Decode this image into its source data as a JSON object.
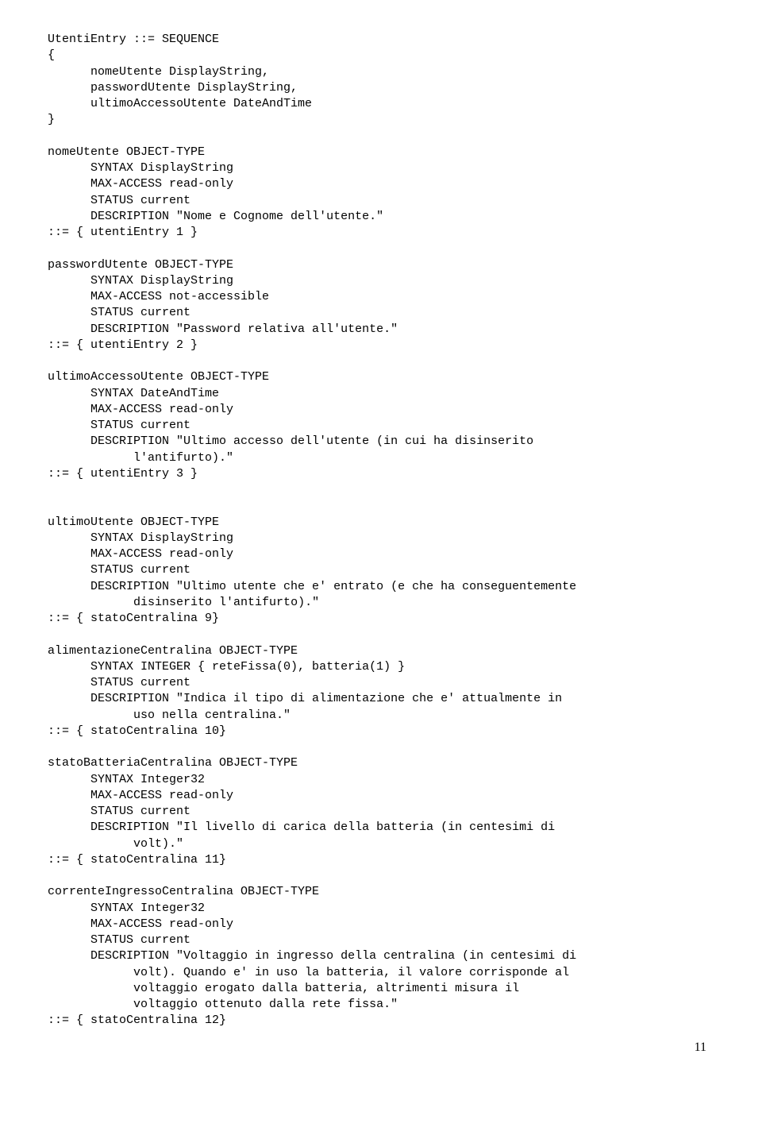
{
  "code": "UtentiEntry ::= SEQUENCE\n{\n      nomeUtente DisplayString,\n      passwordUtente DisplayString,\n      ultimoAccessoUtente DateAndTime\n}\n\nnomeUtente OBJECT-TYPE\n      SYNTAX DisplayString\n      MAX-ACCESS read-only\n      STATUS current\n      DESCRIPTION \"Nome e Cognome dell'utente.\"\n::= { utentiEntry 1 }\n\npasswordUtente OBJECT-TYPE\n      SYNTAX DisplayString\n      MAX-ACCESS not-accessible\n      STATUS current\n      DESCRIPTION \"Password relativa all'utente.\"\n::= { utentiEntry 2 }\n\nultimoAccessoUtente OBJECT-TYPE\n      SYNTAX DateAndTime\n      MAX-ACCESS read-only\n      STATUS current\n      DESCRIPTION \"Ultimo accesso dell'utente (in cui ha disinserito\n            l'antifurto).\"\n::= { utentiEntry 3 }\n\n\nultimoUtente OBJECT-TYPE\n      SYNTAX DisplayString\n      MAX-ACCESS read-only\n      STATUS current\n      DESCRIPTION \"Ultimo utente che e' entrato (e che ha conseguentemente\n            disinserito l'antifurto).\"\n::= { statoCentralina 9}\n\nalimentazioneCentralina OBJECT-TYPE\n      SYNTAX INTEGER { reteFissa(0), batteria(1) }\n      STATUS current\n      DESCRIPTION \"Indica il tipo di alimentazione che e' attualmente in\n            uso nella centralina.\"\n::= { statoCentralina 10}\n\nstatoBatteriaCentralina OBJECT-TYPE\n      SYNTAX Integer32\n      MAX-ACCESS read-only\n      STATUS current\n      DESCRIPTION \"Il livello di carica della batteria (in centesimi di\n            volt).\"\n::= { statoCentralina 11}\n\ncorrenteIngressoCentralina OBJECT-TYPE\n      SYNTAX Integer32\n      MAX-ACCESS read-only\n      STATUS current\n      DESCRIPTION \"Voltaggio in ingresso della centralina (in centesimi di\n            volt). Quando e' in uso la batteria, il valore corrisponde al\n            voltaggio erogato dalla batteria, altrimenti misura il\n            voltaggio ottenuto dalla rete fissa.\"\n::= { statoCentralina 12}",
  "pageNumber": "11"
}
